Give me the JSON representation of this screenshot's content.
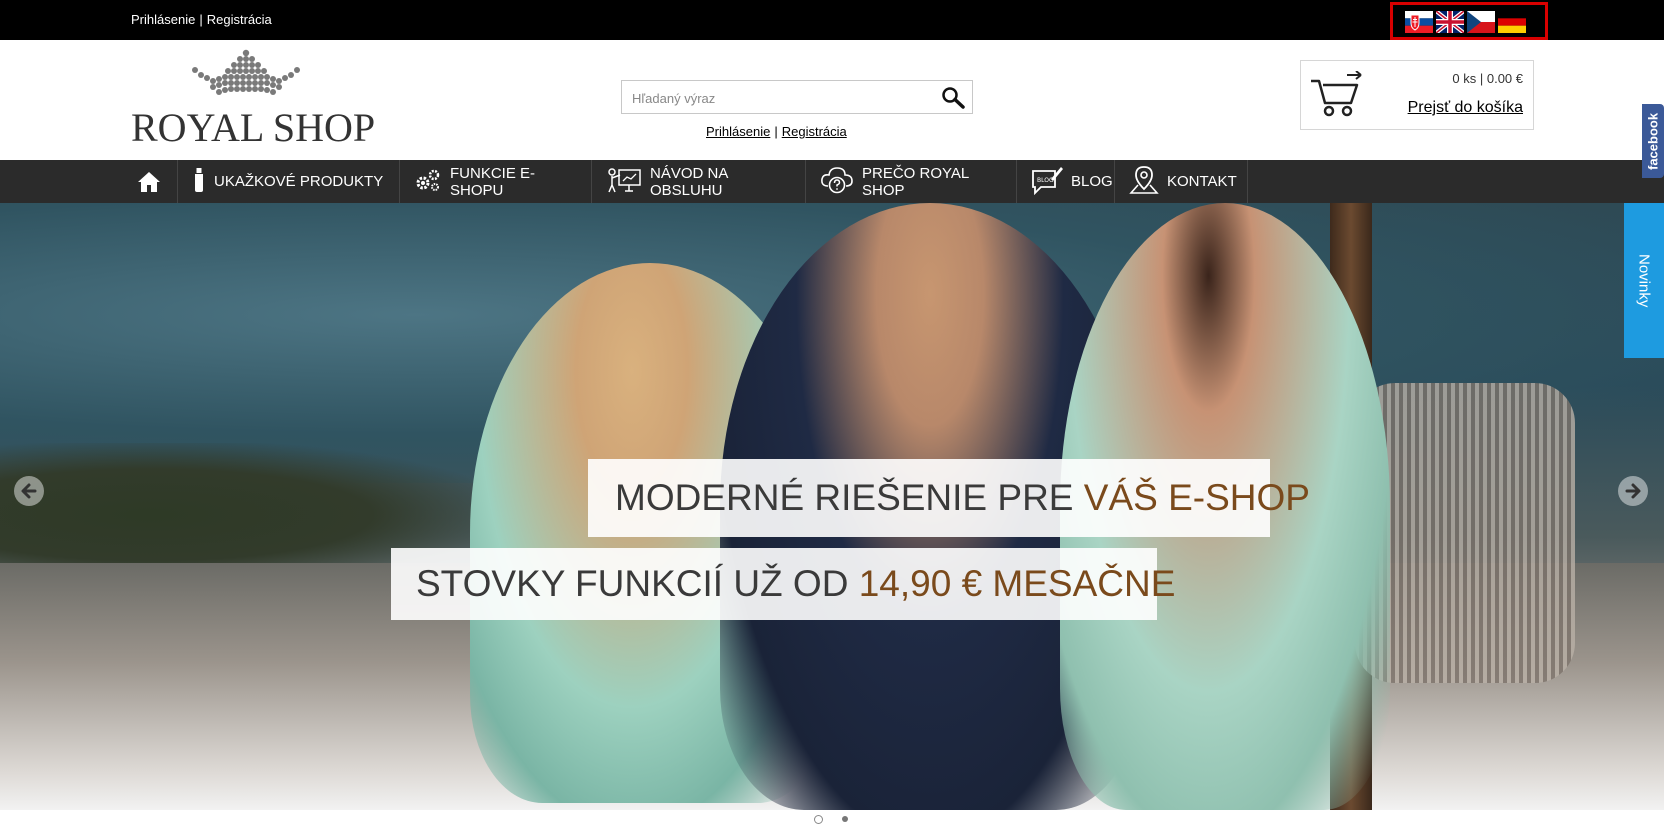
{
  "topbar": {
    "login": "Prihlásenie",
    "separator": "|",
    "register": "Registrácia",
    "flags": [
      "slovak-flag",
      "uk-flag",
      "czech-flag",
      "german-flag"
    ]
  },
  "logo": {
    "text": "ROYAL SHOP"
  },
  "search": {
    "placeholder": "Hľadaný výraz",
    "login": "Prihlásenie",
    "separator": "|",
    "register": "Registrácia"
  },
  "cart": {
    "summary": "0 ks | 0.00 €",
    "link": "Prejsť do košíka"
  },
  "nav": {
    "items": [
      {
        "label": "",
        "icon": "home-icon"
      },
      {
        "label": "UKAŽKOVÉ PRODUKTY",
        "icon": "bottle-icon"
      },
      {
        "label": "FUNKCIE E-SHOPU",
        "icon": "gears-icon"
      },
      {
        "label": "NÁVOD NA OBSLUHU",
        "icon": "presentation-icon"
      },
      {
        "label": "PREČO ROYAL SHOP",
        "icon": "cloud-question-icon"
      },
      {
        "label": "BLOG",
        "icon": "blog-icon"
      },
      {
        "label": "KONTAKT",
        "icon": "location-pin-icon"
      }
    ]
  },
  "hero": {
    "line1_main": "MODERNÉ RIEŠENIE PRE ",
    "line1_accent": "VÁŠ E-SHOP",
    "line2_main": "STOVKY FUNKCIÍ UŽ OD ",
    "line2_accent": "14,90 € MESAČNE"
  },
  "side": {
    "facebook": "facebook",
    "news": "Novinky"
  },
  "colors": {
    "accent": "#7a4a1c",
    "nav_bg": "#2b2b2b",
    "news_tab": "#1e9be0",
    "facebook": "#3b5998",
    "highlight_border": "#d90000"
  }
}
